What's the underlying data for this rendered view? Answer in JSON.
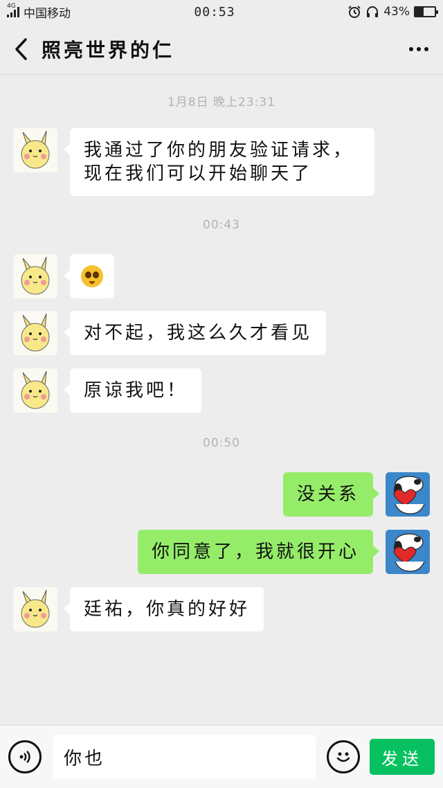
{
  "status_bar": {
    "network": "4G",
    "carrier": "中国移动",
    "time": "00:53",
    "battery_text": "43%",
    "battery_level": 0.43
  },
  "header": {
    "title": "照亮世界的仁"
  },
  "timestamps": [
    "1月8日 晚上23:31",
    "00:43",
    "00:50"
  ],
  "messages": [
    {
      "side": "in",
      "text": "我通过了你的朋友验证请求，现在我们可以开始聊天了"
    },
    {
      "side": "in",
      "kind": "emoji",
      "emoji": "cute-face-emoji"
    },
    {
      "side": "in",
      "text": "对不起，我这么久才看见"
    },
    {
      "side": "in",
      "text": "原谅我吧！"
    },
    {
      "side": "out",
      "text": "没关系"
    },
    {
      "side": "out",
      "text": "你同意了，我就很开心"
    },
    {
      "side": "in",
      "text": "廷祐，你真的好好"
    }
  ],
  "input": {
    "value": "你也",
    "send_label": "发送"
  },
  "colors": {
    "background": "#ededed",
    "outgoing_bubble": "#95ec69",
    "send_button": "#07c160"
  }
}
